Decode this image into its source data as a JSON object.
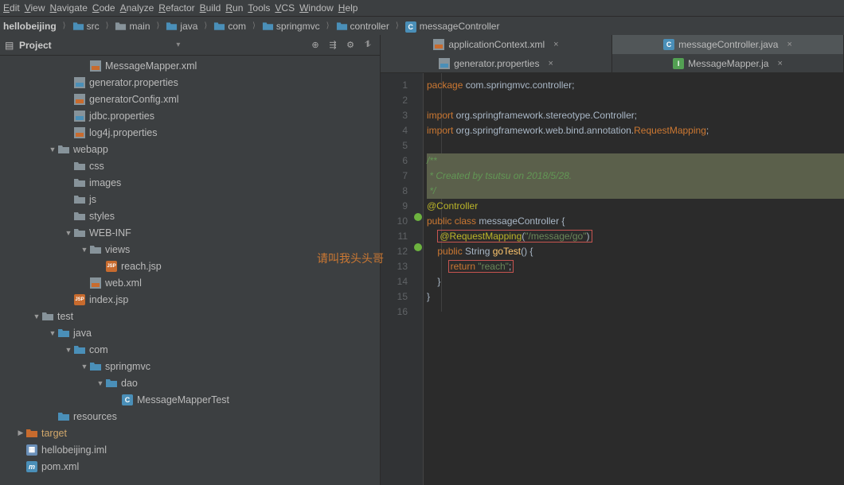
{
  "menu": [
    "Edit",
    "View",
    "Navigate",
    "Code",
    "Analyze",
    "Refactor",
    "Build",
    "Run",
    "Tools",
    "VCS",
    "Window",
    "Help"
  ],
  "breadcrumb": [
    {
      "label": "hellobeijing",
      "type": "root"
    },
    {
      "label": "src",
      "type": "src"
    },
    {
      "label": "main",
      "type": "dir"
    },
    {
      "label": "java",
      "type": "src"
    },
    {
      "label": "com",
      "type": "pkg"
    },
    {
      "label": "springmvc",
      "type": "pkg"
    },
    {
      "label": "controller",
      "type": "pkg"
    },
    {
      "label": "messageController",
      "type": "class"
    }
  ],
  "project_header": {
    "title": "Project",
    "dropdown": "▾"
  },
  "tree": [
    {
      "indent": 5,
      "icon": "xml",
      "label": "MessageMapper.xml"
    },
    {
      "indent": 4,
      "icon": "prop",
      "label": "generator.properties"
    },
    {
      "indent": 4,
      "icon": "xml",
      "label": "generatorConfig.xml"
    },
    {
      "indent": 4,
      "icon": "prop",
      "label": "jdbc.properties"
    },
    {
      "indent": 4,
      "icon": "xml",
      "label": "log4j.properties"
    },
    {
      "indent": 3,
      "arrow": "▼",
      "icon": "dir",
      "label": "webapp"
    },
    {
      "indent": 4,
      "icon": "dir",
      "label": "css"
    },
    {
      "indent": 4,
      "icon": "dir",
      "label": "images"
    },
    {
      "indent": 4,
      "icon": "dir",
      "label": "js"
    },
    {
      "indent": 4,
      "icon": "dir",
      "label": "styles"
    },
    {
      "indent": 4,
      "arrow": "▼",
      "icon": "dir",
      "label": "WEB-INF"
    },
    {
      "indent": 5,
      "arrow": "▼",
      "icon": "dir",
      "label": "views"
    },
    {
      "indent": 6,
      "icon": "jsp",
      "label": "reach.jsp"
    },
    {
      "indent": 5,
      "icon": "xml",
      "label": "web.xml"
    },
    {
      "indent": 4,
      "icon": "jsp",
      "label": "index.jsp"
    },
    {
      "indent": 2,
      "arrow": "▼",
      "icon": "dir",
      "label": "test"
    },
    {
      "indent": 3,
      "arrow": "▼",
      "icon": "src",
      "label": "java"
    },
    {
      "indent": 4,
      "arrow": "▼",
      "icon": "pkg",
      "label": "com"
    },
    {
      "indent": 5,
      "arrow": "▼",
      "icon": "pkg",
      "label": "springmvc"
    },
    {
      "indent": 6,
      "arrow": "▼",
      "icon": "pkg",
      "label": "dao"
    },
    {
      "indent": 7,
      "icon": "cls",
      "label": "MessageMapperTest"
    },
    {
      "indent": 3,
      "icon": "res",
      "label": "resources"
    },
    {
      "indent": 1,
      "arrow": "▶",
      "icon": "tgt",
      "label": "target",
      "orange": true
    },
    {
      "indent": 1,
      "icon": "iml",
      "label": "hellobeijing.iml"
    },
    {
      "indent": 1,
      "icon": "m",
      "label": "pom.xml"
    }
  ],
  "watermark": "请叫我头头哥",
  "tabs_top": [
    {
      "icon": "xml",
      "label": "applicationContext.xml",
      "active": false
    },
    {
      "icon": "cls",
      "label": "messageController.java",
      "active": true
    }
  ],
  "tabs_bot": [
    {
      "icon": "prop",
      "label": "generator.properties",
      "active": false
    },
    {
      "icon": "int",
      "label": "MessageMapper.ja",
      "active": false
    }
  ],
  "code": {
    "lines": [
      "1",
      "2",
      "3",
      "4",
      "5",
      "6",
      "7",
      "8",
      "9",
      "10",
      "11",
      "12",
      "13",
      "14",
      "15",
      "16"
    ],
    "l1": {
      "kw": "package",
      "pkg": " com.springmvc.controller;"
    },
    "l3": {
      "kw": "import",
      "p": " org.springframework.stereotype.",
      "c": "Controller",
      ";": ";"
    },
    "l4": {
      "kw": "import",
      "p": " org.springframework.web.bind.annotation.",
      "c": "RequestMapping",
      ";": ";"
    },
    "l6": "/**",
    "l7": " * Created by tsutsu on 2018/5/28.",
    "l8": " */",
    "l9": "@Controller",
    "l10": {
      "kw": "public class ",
      "cls": "messageController",
      " b": " {"
    },
    "l11": {
      "ann": "@RequestMapping",
      "paren": "(",
      "str": "\"/message/go\"",
      "cp": ")"
    },
    "l12": {
      "kw": "public ",
      "t": "String ",
      "m": "goTest",
      "r": "() {"
    },
    "l13": {
      "kw": "return ",
      "str": "\"reach\"",
      ";": ";"
    },
    "l14": "    }",
    "l15": "}"
  }
}
